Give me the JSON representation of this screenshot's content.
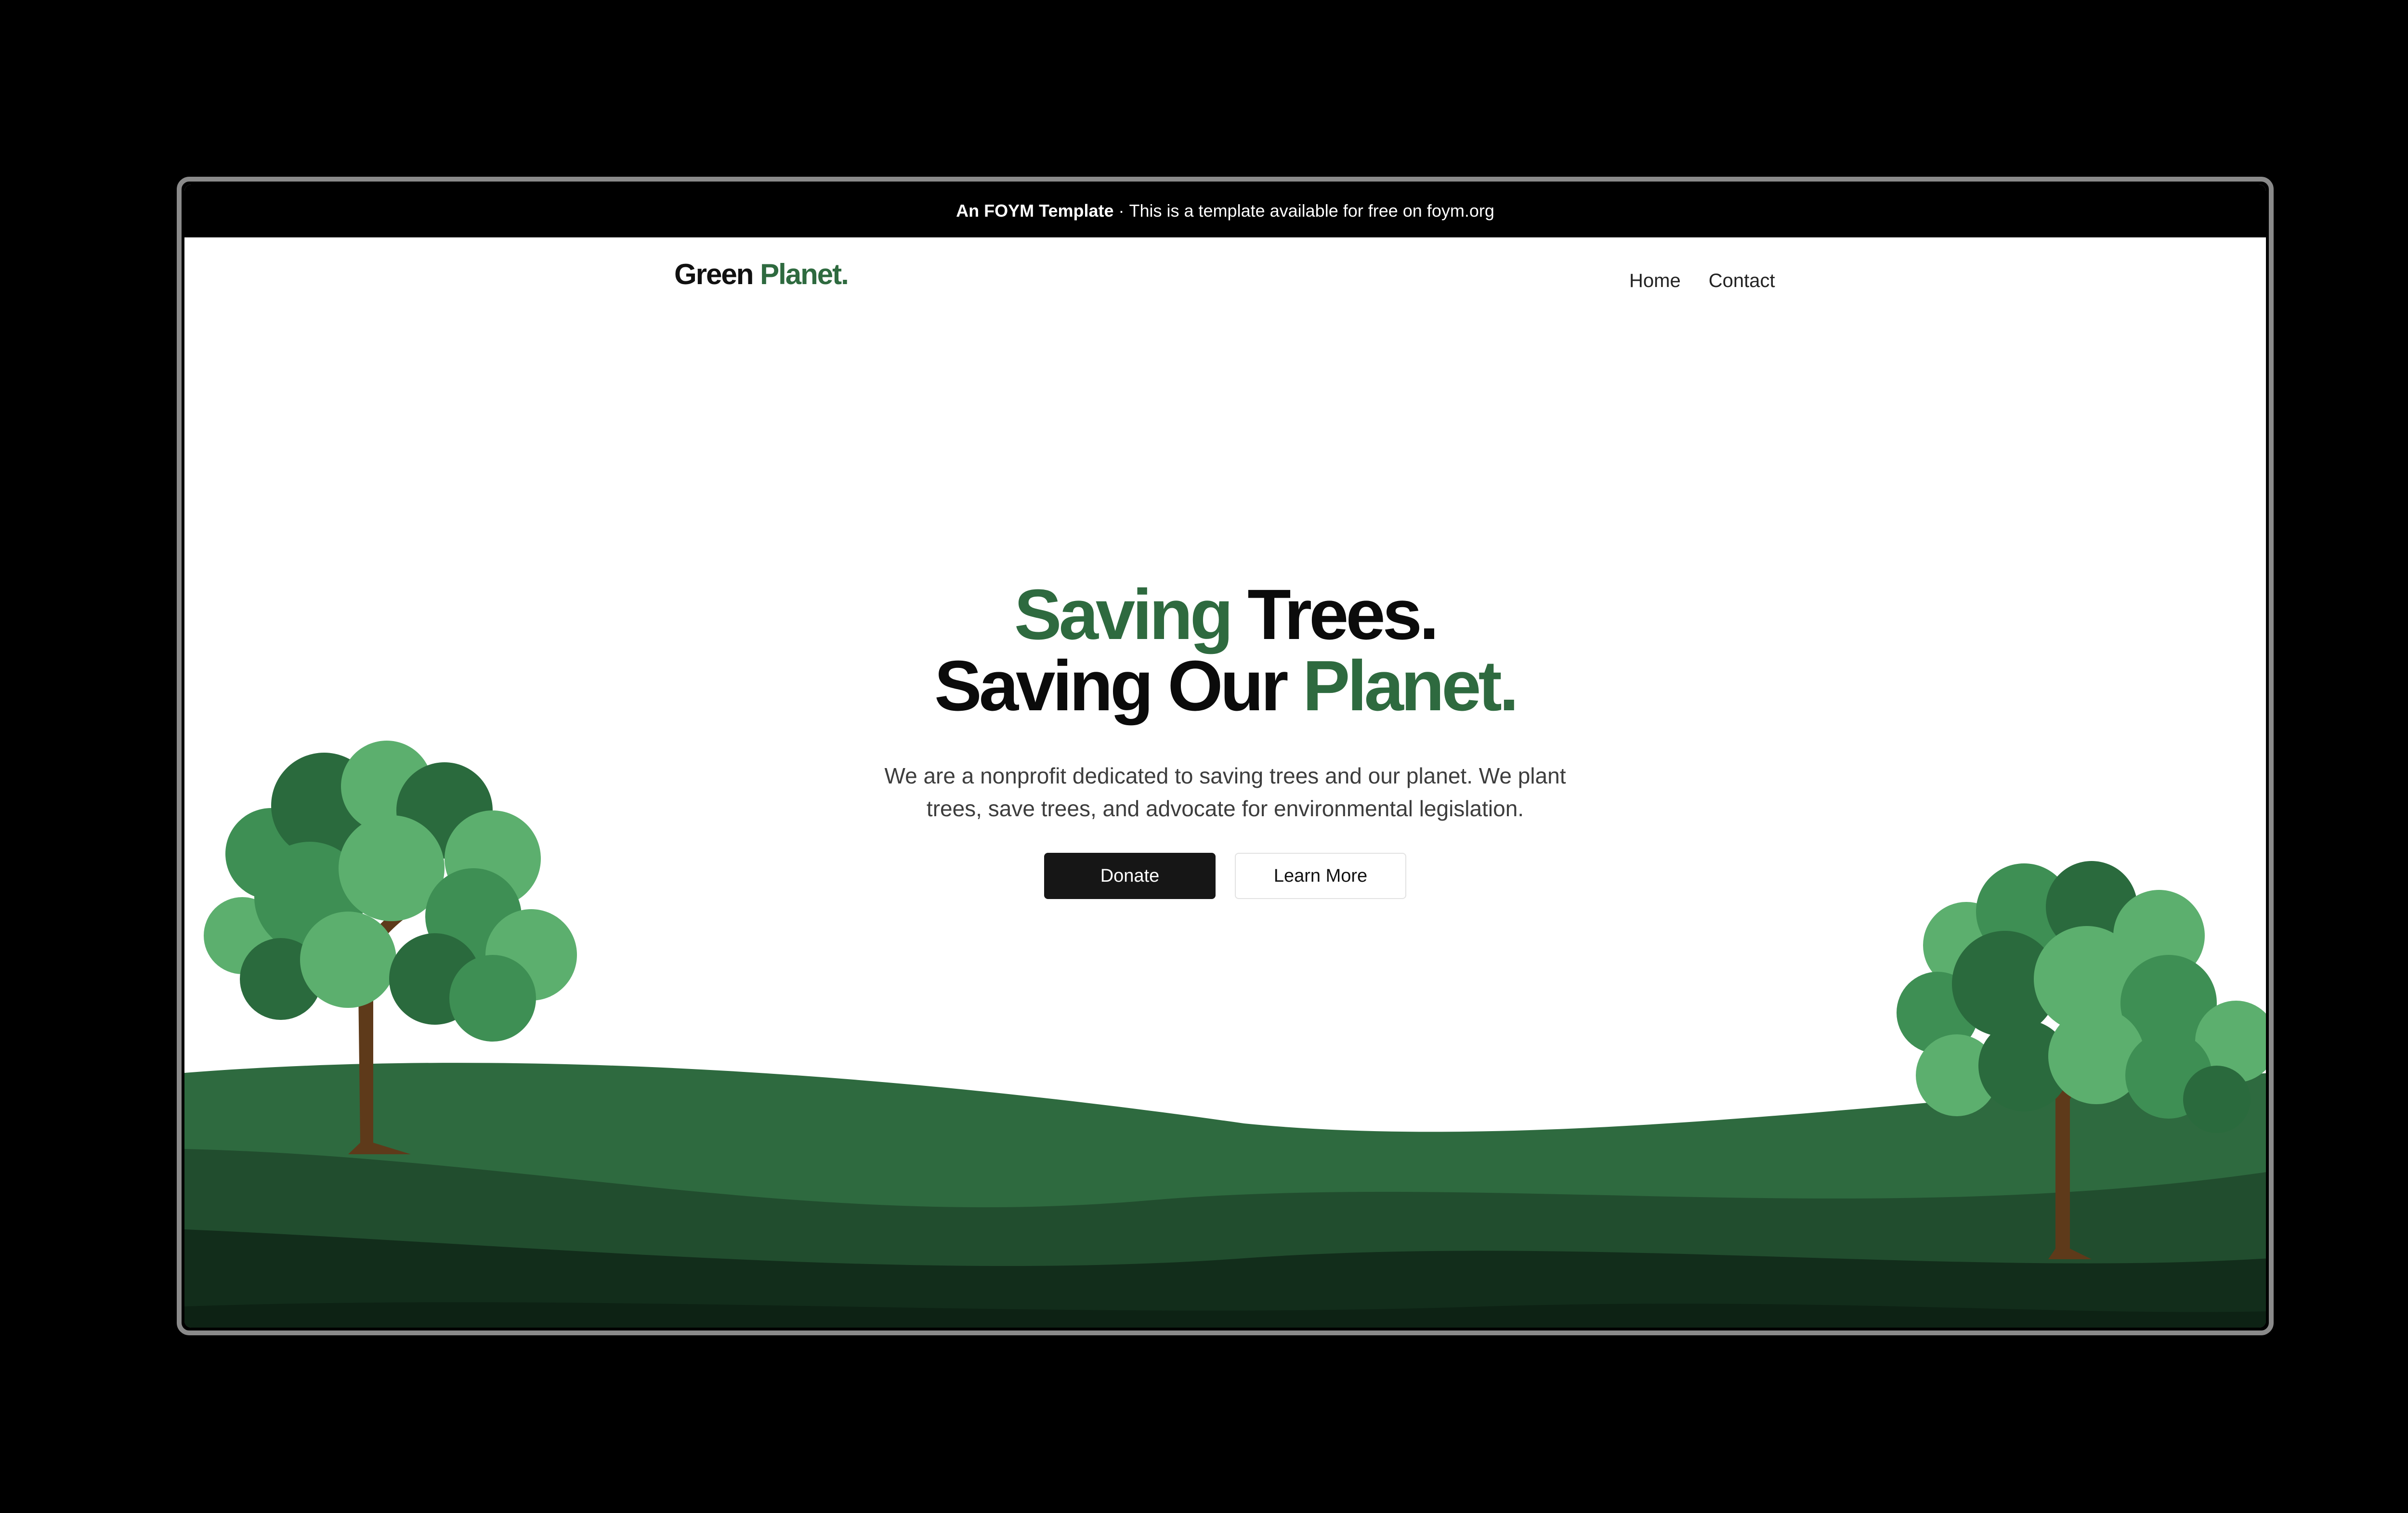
{
  "banner": {
    "brand": "An FOYM Template",
    "separator": "·",
    "message": "This is a template available for free on foym.org"
  },
  "logo": {
    "part1": "Green",
    "part2": "Planet."
  },
  "nav": {
    "home": "Home",
    "contact": "Contact"
  },
  "hero": {
    "line1_green": "Saving",
    "line1_dark": "Trees.",
    "line2_dark": "Saving Our",
    "line2_green": "Planet.",
    "description": "We are a nonprofit dedicated to saving trees and our planet. We plant trees, save trees, and advocate for environmental legislation.",
    "donate_label": "Donate",
    "learn_label": "Learn More"
  },
  "colors": {
    "accent": "#2e6a3f",
    "hill1": "#2e6a3f",
    "hill2": "#214d2e",
    "hill3": "#122d1b",
    "trunk": "#5e3a1a",
    "leaf_light": "#5caf6e",
    "leaf_mid": "#3e8f54",
    "leaf_dark": "#2a6a3d"
  }
}
